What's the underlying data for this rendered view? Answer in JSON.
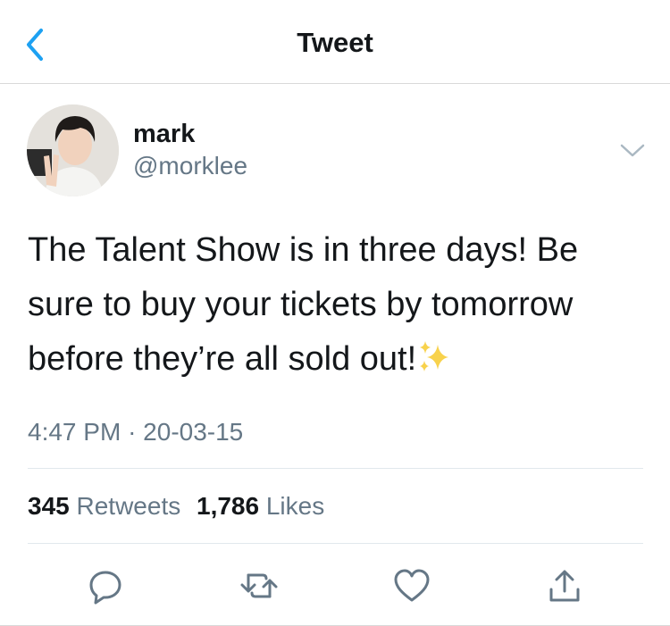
{
  "header": {
    "title": "Tweet",
    "back_icon": "chevron-left-icon"
  },
  "tweet": {
    "author": {
      "display_name": "mark",
      "handle": "@morklee"
    },
    "text": "The Talent Show is in three days! Be sure to buy your tickets by tomorrow before they’re all sold out!",
    "emoji": "sparkles-icon",
    "time": "4:47 PM",
    "separator": "·",
    "date": "20-03-15",
    "stats": {
      "retweets_count": "345",
      "retweets_label": "Retweets",
      "likes_count": "1,786",
      "likes_label": "Likes"
    }
  },
  "actions": [
    {
      "icon": "reply-icon"
    },
    {
      "icon": "retweet-icon"
    },
    {
      "icon": "like-icon"
    },
    {
      "icon": "share-icon"
    }
  ],
  "colors": {
    "accent": "#1da1f2",
    "text_primary": "#14171a",
    "text_secondary": "#657786",
    "divider": "#e1e8ed"
  }
}
